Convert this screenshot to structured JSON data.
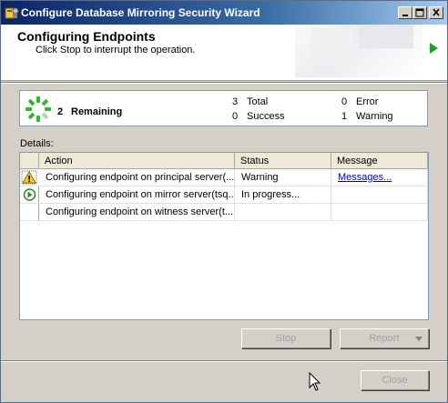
{
  "window": {
    "title": "Configure Database Mirroring Security Wizard",
    "icon": "wizard-app-icon",
    "caption_buttons": [
      "minimize",
      "maximize",
      "close"
    ]
  },
  "header": {
    "title": "Configuring Endpoints",
    "subtitle": "Click Stop to interrupt the operation."
  },
  "summary": {
    "remaining_count": "2",
    "remaining_label": "Remaining",
    "total_count": "3",
    "total_label": "Total",
    "success_count": "0",
    "success_label": "Success",
    "error_count": "0",
    "error_label": "Error",
    "warning_count": "1",
    "warning_label": "Warning"
  },
  "details": {
    "label": "Details:",
    "columns": [
      "Action",
      "Status",
      "Message"
    ],
    "rows": [
      {
        "icon": "warning-icon",
        "action": "Configuring endpoint on principal server(...",
        "status": "Warning",
        "message": "Messages..."
      },
      {
        "icon": "in-progress-icon",
        "action": "Configuring endpoint on mirror server(tsq...",
        "status": "In progress...",
        "message": ""
      },
      {
        "icon": "",
        "action": "Configuring endpoint on witness server(t...",
        "status": "",
        "message": ""
      }
    ]
  },
  "buttons": {
    "stop": "Stop",
    "report": "Report",
    "close": "Close"
  },
  "colors": {
    "title_bar_start": "#0a246a",
    "title_bar_end": "#a6caf0",
    "spinner": "#2db82d",
    "link": "#0000cc",
    "header_arrow": "#1d9d2d"
  }
}
